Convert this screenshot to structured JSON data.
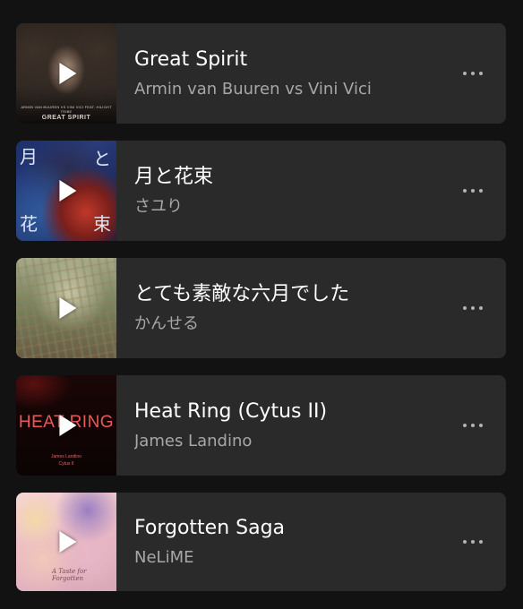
{
  "tracks": [
    {
      "title": "Great Spirit",
      "artist": "Armin van Buuren vs Vini Vici",
      "art": {
        "caption_small": "ARMIN VAN BUUREN VS VINI VICI FEAT. HILIGHT TRIBE",
        "caption_large": "GREAT SPIRIT"
      }
    },
    {
      "title": "月と花束",
      "artist": "さユり",
      "art": {
        "kanji_tl": "月",
        "kanji_tr": "と",
        "kanji_bl": "花",
        "kanji_br": "束"
      }
    },
    {
      "title": "とても素敵な六月でした",
      "artist": "かんせる",
      "art": {}
    },
    {
      "title": "Heat Ring (Cytus II)",
      "artist": "James Landino",
      "art": {
        "caption_large": "HEAT RING",
        "caption_small_1": "James Landino",
        "caption_small_2": "Cytus II"
      }
    },
    {
      "title": "Forgotten Saga",
      "artist": "NeLiME",
      "art": {
        "signature": "A Taste for Forgotten"
      }
    }
  ],
  "icons": {
    "play": "play-icon",
    "more": "more-options-icon"
  },
  "colors": {
    "background": "#121212",
    "card": "#2a2a2a",
    "title": "#ffffff",
    "subtitle": "#a7a7a7"
  }
}
